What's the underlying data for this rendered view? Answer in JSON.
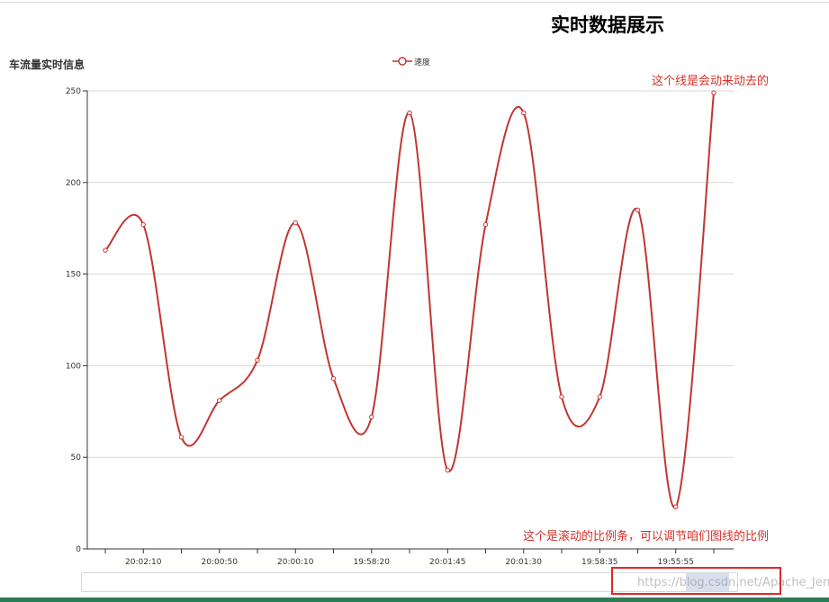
{
  "page": {
    "title": "实时数据展示"
  },
  "annotations": {
    "line_note": "这个线是会动来动去的",
    "zoom_note": "这个是滚动的比例条，可以调节咱们图线的比例"
  },
  "watermark": "https://blog.csdn.net/Apache_Jerry",
  "colors": {
    "series": "#c23531",
    "annotation": "#d6312a",
    "highlight": "#e02828"
  },
  "chart_data": {
    "type": "line",
    "title": "车流量实时信息",
    "xlabel": "",
    "ylabel": "",
    "ylim": [
      0,
      250
    ],
    "y_ticks": [
      "0",
      "50",
      "100",
      "150",
      "200",
      "250"
    ],
    "x_tick_labels": [
      "20:02:10",
      "20:00:50",
      "20:00:10",
      "19:58:20",
      "20:01:45",
      "20:01:30",
      "19:58:35",
      "19:55:55"
    ],
    "legend_position": "top-center",
    "grid": true,
    "smooth": true,
    "series": [
      {
        "name": "速度",
        "values": [
          163,
          177,
          61,
          81,
          103,
          178,
          93,
          72,
          238,
          43,
          177,
          238,
          83,
          83,
          185,
          23,
          249
        ]
      }
    ],
    "data_zoom": {
      "type": "slider",
      "start": 0.93,
      "end": 1.0
    }
  }
}
